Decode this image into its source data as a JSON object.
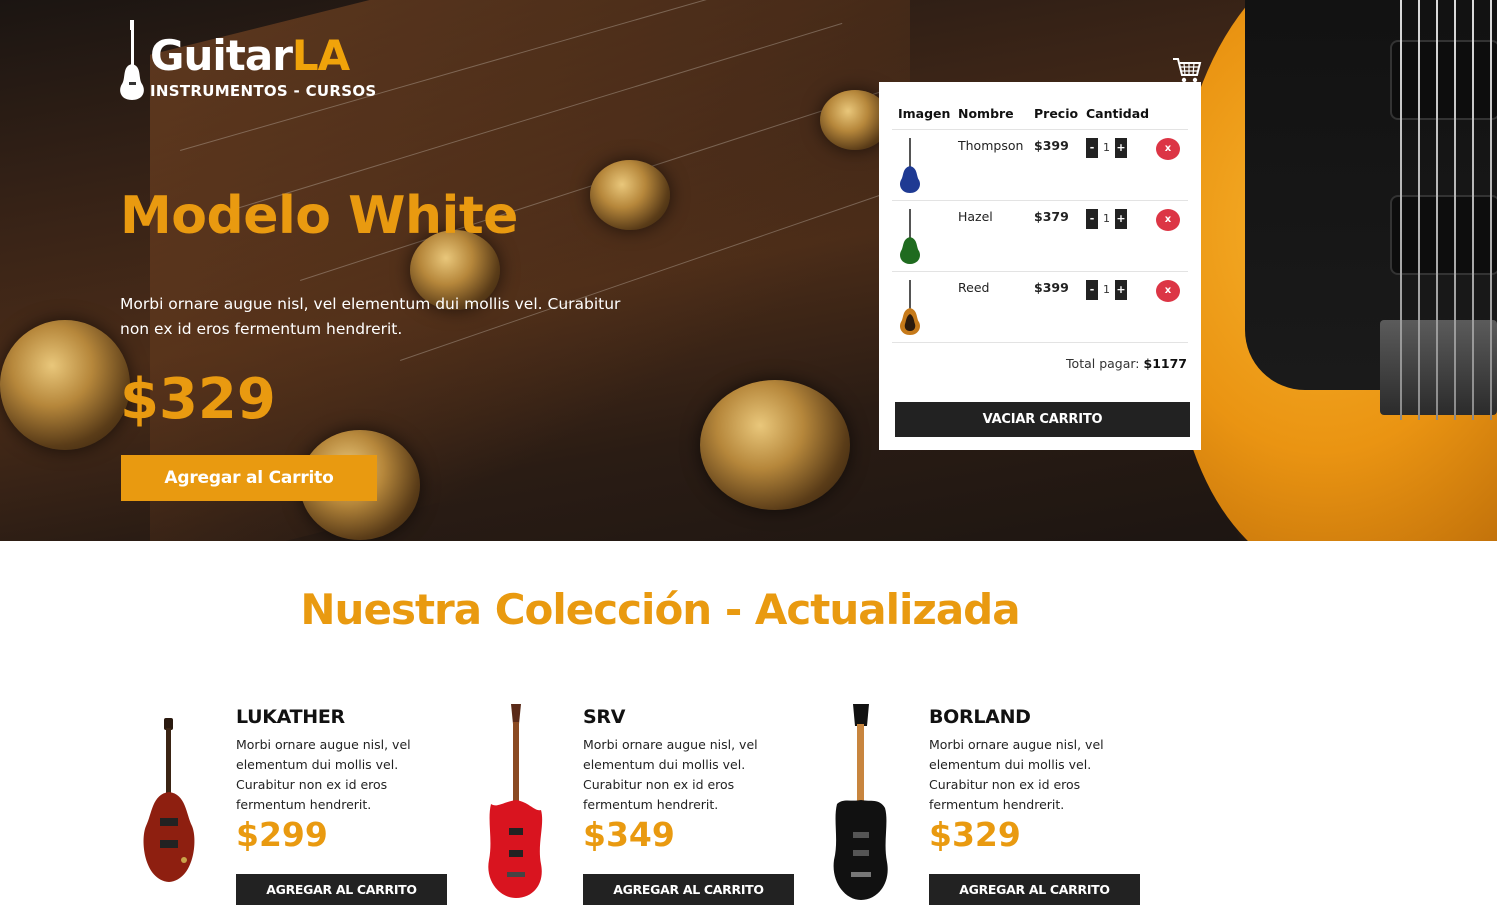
{
  "header": {
    "logo": {
      "word_part1": "Guitar",
      "word_part2": "LA",
      "tagline": "INSTRUMENTOS - CURSOS"
    },
    "hero": {
      "title": "Modelo White",
      "description": "Morbi ornare augue nisl, vel elementum dui mollis vel. Curabitur non ex id eros fermentum hendrerit.",
      "price": "$329",
      "button_label": "Agregar al Carrito"
    }
  },
  "cart": {
    "icon": "shopping-cart-icon",
    "columns": [
      "Imagen",
      "Nombre",
      "Precio",
      "Cantidad"
    ],
    "items": [
      {
        "name": "Thompson",
        "price": "$399",
        "quantity": "1",
        "minus": "-",
        "plus": "+",
        "remove": "x",
        "color": "#1f3a93"
      },
      {
        "name": "Hazel",
        "price": "$379",
        "quantity": "1",
        "minus": "-",
        "plus": "+",
        "remove": "x",
        "color": "#1f6b1f"
      },
      {
        "name": "Reed",
        "price": "$399",
        "quantity": "1",
        "minus": "-",
        "plus": "+",
        "remove": "x",
        "color": "#c67a1a"
      }
    ],
    "total_label": "Total pagar: ",
    "total_value": "$1177",
    "empty_button": "VACIAR CARRITO"
  },
  "collection": {
    "title": "Nuestra Colección - Actualizada",
    "products": [
      {
        "name": "LUKATHER",
        "description": "Morbi ornare augue nisl, vel elementum dui mollis vel. Curabitur non ex id eros fermentum hendrerit.",
        "price": "$299",
        "button_label": "AGREGAR AL CARRITO",
        "color": "#8e1f10"
      },
      {
        "name": "SRV",
        "description": "Morbi ornare augue nisl, vel elementum dui mollis vel. Curabitur non ex id eros fermentum hendrerit.",
        "price": "$349",
        "button_label": "AGREGAR AL CARRITO",
        "color": "#d9141f"
      },
      {
        "name": "BORLAND",
        "description": "Morbi ornare augue nisl, vel elementum dui mollis vel. Curabitur non ex id eros fermentum hendrerit.",
        "price": "$329",
        "button_label": "AGREGAR AL CARRITO",
        "color": "#111111"
      }
    ]
  },
  "colors": {
    "accent": "#e99a10",
    "dark": "#222222",
    "danger": "#dc3545"
  }
}
